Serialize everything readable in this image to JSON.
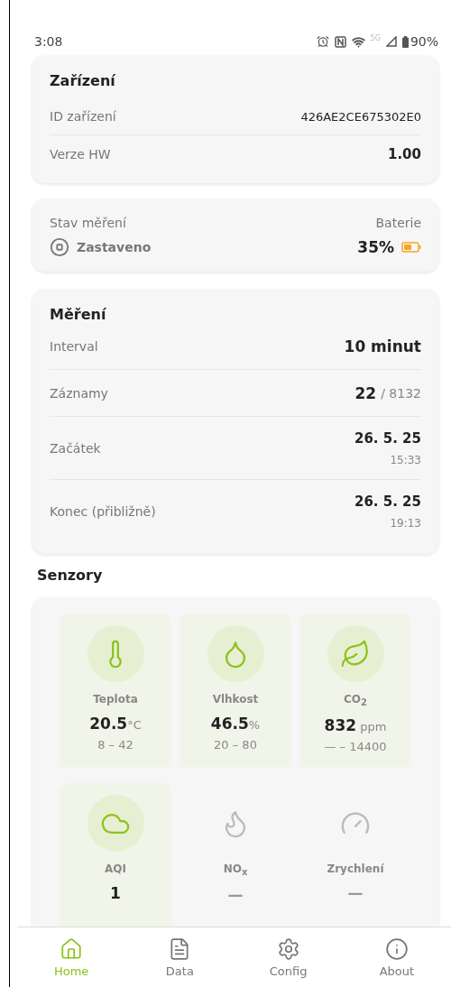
{
  "status_bar": {
    "time": "3:08",
    "network": "5G",
    "battery": "90%"
  },
  "device_card": {
    "title": "Zařízení",
    "rows": [
      {
        "label": "ID zařízení",
        "value": "426AE2CE675302E0",
        "kind": "plain"
      },
      {
        "label": "Verze HW",
        "value": "1.00",
        "kind": "bold"
      }
    ]
  },
  "status_card": {
    "state_label": "Stav měření",
    "state": "Zastaveno",
    "battery_label": "Baterie",
    "battery": "35%"
  },
  "measurement_card": {
    "title": "Měření",
    "rows": [
      {
        "kind": "single",
        "label": "Interval",
        "value": "10 minut"
      },
      {
        "kind": "count",
        "label": "Záznamy",
        "value": "22",
        "total": "/ 8132"
      },
      {
        "kind": "date",
        "label": "Začátek",
        "value": "26. 5. 25",
        "time": "15:33"
      },
      {
        "kind": "date",
        "label": "Konec (přibližně)",
        "value": "26. 5. 25",
        "time": "19:13"
      }
    ]
  },
  "sensors": {
    "title": "Senzory",
    "items": [
      {
        "kind": "thermometer",
        "active": true,
        "label": "Teplota",
        "value": "20.5",
        "unit": "°C",
        "range": "8 – 42"
      },
      {
        "kind": "droplet",
        "active": true,
        "label": "Vlhkost",
        "value": "46.5",
        "unit": "%",
        "range": "20 – 80"
      },
      {
        "kind": "leaf",
        "active": true,
        "label": "CO$_{2}$",
        "value": "832",
        "unit": "ppm",
        "range": "— – 14400"
      },
      {
        "kind": "cloud",
        "active": true,
        "label": "AQI",
        "value": "1"
      },
      {
        "kind": "flame",
        "active": false,
        "label": "NO$_{x}$",
        "value": "—"
      },
      {
        "kind": "gauge",
        "active": false,
        "label": "Zrychlení",
        "value": "—"
      }
    ]
  },
  "nav": [
    {
      "label": "Home",
      "selected": true
    },
    {
      "label": "Data",
      "selected": false
    },
    {
      "label": "Config",
      "selected": false
    },
    {
      "label": "About",
      "selected": false
    }
  ]
}
